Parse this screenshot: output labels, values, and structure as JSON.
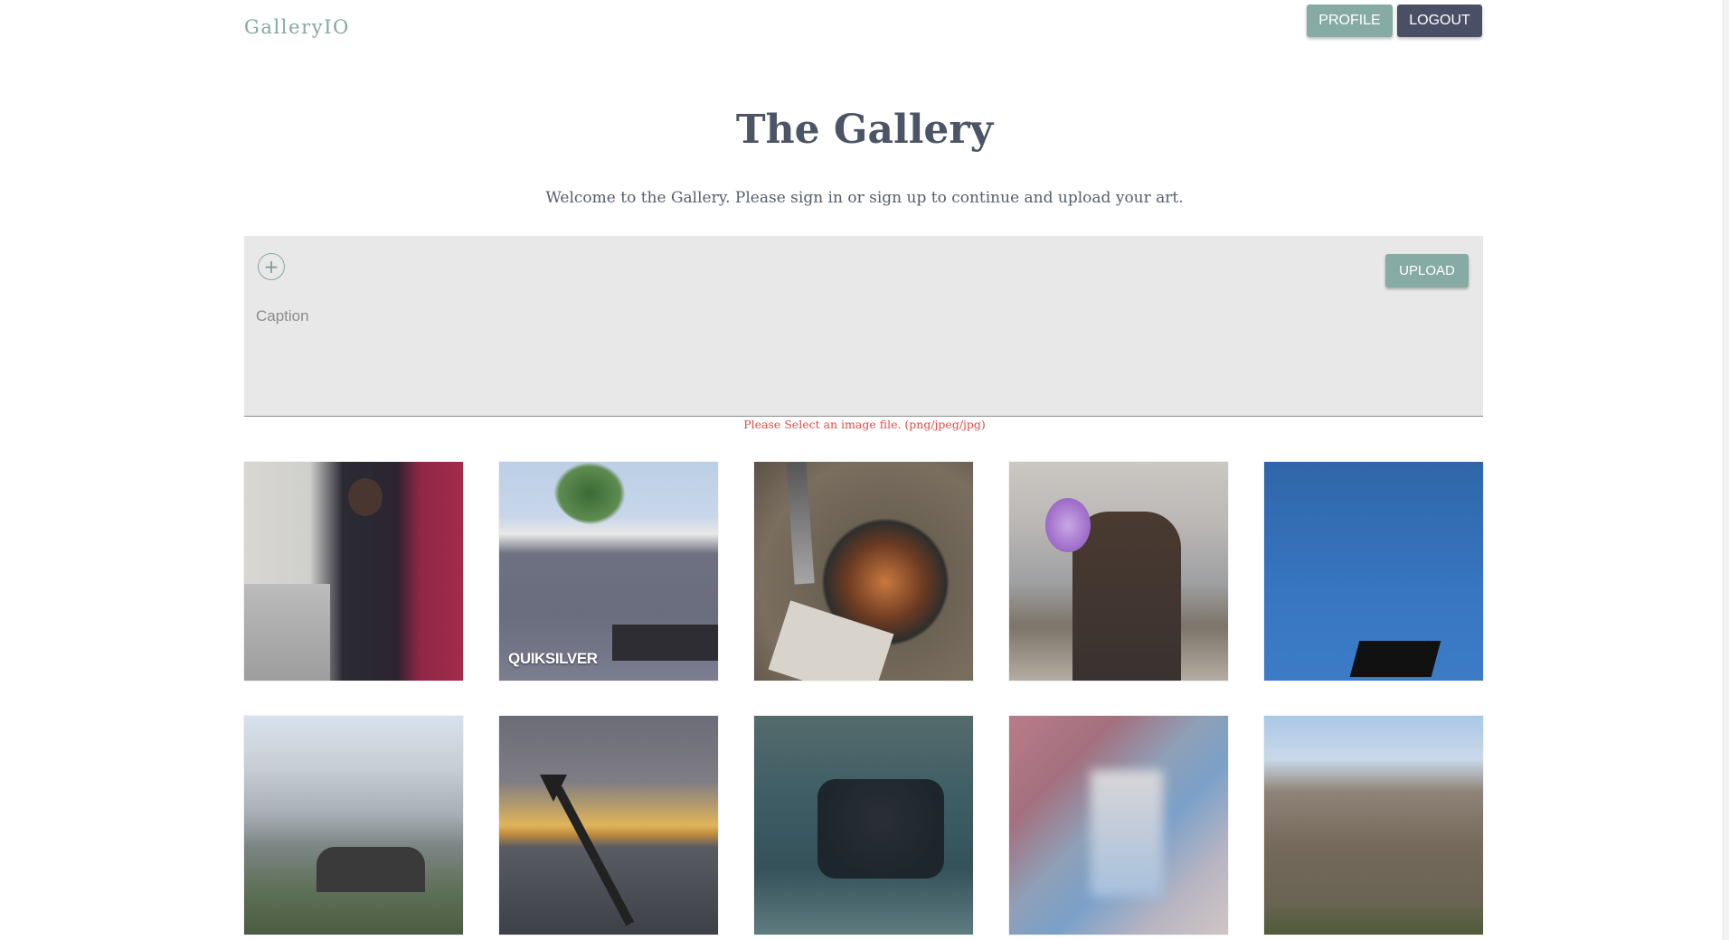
{
  "header": {
    "brand": "GalleryIO",
    "profile_label": "PROFILE",
    "logout_label": "LOGOUT"
  },
  "hero": {
    "title": "The Gallery",
    "subtitle": "Welcome to the Gallery. Please sign in or sign up to continue and upload your art."
  },
  "upload": {
    "add_icon": "+",
    "caption_placeholder": "Caption",
    "caption_value": "",
    "upload_label": "UPLOAD",
    "error": "Please Select an image file. (png/jpeg/jpg)"
  },
  "gallery": {
    "photos": [
      {
        "caption": ""
      },
      {
        "caption": "QUIKSILVER"
      },
      {
        "caption": ""
      },
      {
        "caption": ""
      },
      {
        "caption": ""
      },
      {
        "caption": ""
      },
      {
        "caption": ""
      },
      {
        "caption": ""
      },
      {
        "caption": ""
      },
      {
        "caption": ""
      }
    ]
  },
  "colors": {
    "accent": "#86aba5",
    "dark": "#4b4f66",
    "error": "#e04b4b"
  }
}
